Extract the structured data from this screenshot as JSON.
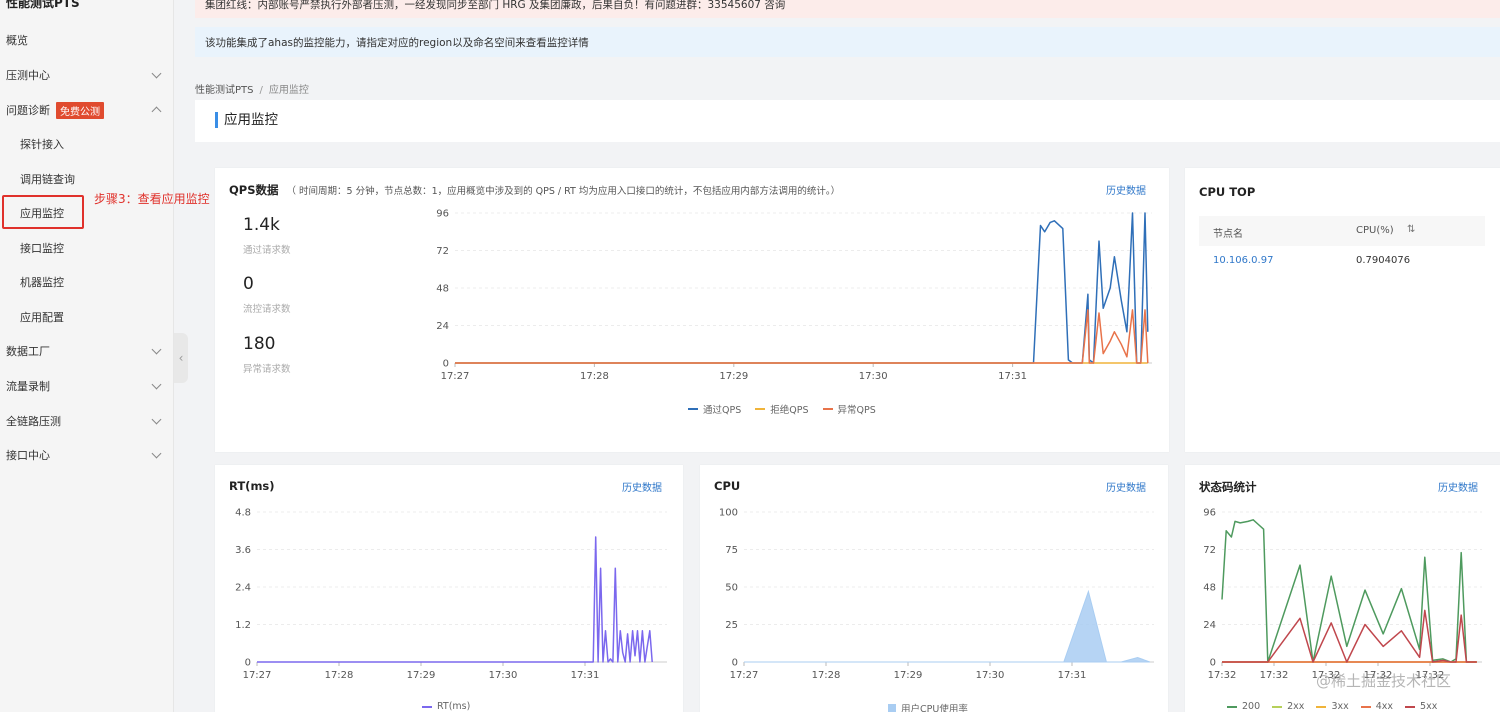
{
  "sidebar": {
    "title": "性能测试PTS",
    "items": [
      {
        "label": "概览",
        "level": 1,
        "chevron": ""
      },
      {
        "label": "压测中心",
        "level": 1,
        "chevron": "down"
      },
      {
        "label": "问题诊断",
        "level": 1,
        "chevron": "up",
        "badge": "免费公测"
      },
      {
        "label": "探针接入",
        "level": 2,
        "chevron": ""
      },
      {
        "label": "调用链查询",
        "level": 2,
        "chevron": ""
      },
      {
        "label": "应用监控",
        "level": 2,
        "chevron": "",
        "active": true
      },
      {
        "label": "接口监控",
        "level": 2,
        "chevron": ""
      },
      {
        "label": "机器监控",
        "level": 2,
        "chevron": ""
      },
      {
        "label": "应用配置",
        "level": 2,
        "chevron": ""
      },
      {
        "label": "数据工厂",
        "level": 1,
        "chevron": "down"
      },
      {
        "label": "流量录制",
        "level": 1,
        "chevron": "down"
      },
      {
        "label": "全链路压测",
        "level": 1,
        "chevron": "down"
      },
      {
        "label": "接口中心",
        "level": 1,
        "chevron": "down"
      }
    ],
    "collapse_icon": "chevron-left-icon"
  },
  "annotation": "步骤3：查看应用监控",
  "alerts": {
    "red": "集团红线：内部账号严禁执行外部者压测，一经发现同步至部门 HRG 及集团廉政，后果自负！有问题进群：33545607 咨询",
    "blue": "该功能集成了ahas的监控能力，请指定对应的region以及命名空间来查看监控详情"
  },
  "breadcrumb": {
    "root": "性能测试PTS",
    "separator": "/",
    "current": "应用监控"
  },
  "page_title": "应用监控",
  "qps_card": {
    "title": "QPS数据",
    "note": "（ 时间周期：5 分钟，节点总数：1，应用概览中涉及到的 QPS / RT 均为应用入口接口的统计，不包括应用内部方法调用的统计。）",
    "history_link": "历史数据",
    "stats": [
      {
        "value": "1.4k",
        "label": "通过请求数"
      },
      {
        "value": "0",
        "label": "流控请求数"
      },
      {
        "value": "180",
        "label": "异常请求数"
      }
    ]
  },
  "cpu_top_card": {
    "title": "CPU TOP",
    "columns": [
      "节点名",
      "CPU(%)"
    ],
    "sort_icon": "sort-icon",
    "rows": [
      {
        "node": "10.106.0.97",
        "cpu": "0.7904076"
      }
    ]
  },
  "rt_card": {
    "title": "RT(ms)",
    "history_link": "历史数据"
  },
  "cpu_card": {
    "title": "CPU",
    "history_link": "历史数据"
  },
  "status_card": {
    "title": "状态码统计",
    "history_link": "历史数据"
  },
  "watermark": "@稀土掘金技术社区",
  "colors": {
    "blue": "#2f6fb8",
    "yellow": "#f0b43a",
    "orange": "#e8734a",
    "purple": "#7b68ee",
    "cpu_fill": "#a9cdf2",
    "green": "#4e9a5e",
    "red": "#c0474d",
    "link": "#2f77c9"
  },
  "chart_data": [
    {
      "id": "qps",
      "type": "line",
      "x_ticks": [
        "17:27",
        "17:28",
        "17:29",
        "17:30",
        "17:31"
      ],
      "y_ticks": [
        "96",
        "72",
        "48",
        "24",
        "0"
      ],
      "ylim": [
        0,
        96
      ],
      "xlim": [
        0,
        5
      ],
      "series": [
        {
          "name": "通过QPS",
          "color": "#2f6fb8",
          "x": [
            0,
            4.15,
            4.2,
            4.23,
            4.27,
            4.3,
            4.36,
            4.4,
            4.43,
            4.47,
            4.5,
            4.54,
            4.55,
            4.58,
            4.62,
            4.65,
            4.7,
            4.73,
            4.78,
            4.82,
            4.86,
            4.89,
            4.92,
            4.95,
            4.97
          ],
          "y": [
            0,
            0,
            88,
            84,
            90,
            91,
            86,
            2,
            0,
            0,
            0,
            44,
            2,
            0,
            78,
            35,
            48,
            68,
            40,
            20,
            96,
            0,
            0,
            96,
            20
          ]
        },
        {
          "name": "拒绝QPS",
          "color": "#f0b43a",
          "x": [
            0,
            4.97
          ],
          "y": [
            0,
            0
          ]
        },
        {
          "name": "异常QPS",
          "color": "#e8734a",
          "x": [
            0,
            4.5,
            4.54,
            4.55,
            4.58,
            4.62,
            4.65,
            4.7,
            4.73,
            4.78,
            4.82,
            4.86,
            4.89,
            4.92,
            4.95,
            4.97
          ],
          "y": [
            0,
            0,
            34,
            0,
            0,
            32,
            6,
            14,
            20,
            12,
            4,
            34,
            0,
            0,
            34,
            0
          ]
        }
      ]
    },
    {
      "id": "rt",
      "type": "line",
      "x_ticks": [
        "17:27",
        "17:28",
        "17:29",
        "17:30",
        "17:31"
      ],
      "y_ticks": [
        "4.8",
        "3.6",
        "2.4",
        "1.2",
        "0"
      ],
      "ylim": [
        0,
        4.8
      ],
      "xlim": [
        0,
        5
      ],
      "series": [
        {
          "name": "RT(ms)",
          "color": "#7b68ee",
          "x": [
            0,
            4.1,
            4.13,
            4.16,
            4.19,
            4.22,
            4.25,
            4.28,
            4.31,
            4.34,
            4.37,
            4.4,
            4.43,
            4.46,
            4.49,
            4.52,
            4.55,
            4.58,
            4.61,
            4.64,
            4.67,
            4.7,
            4.73,
            4.76,
            4.79,
            4.82
          ],
          "y": [
            0,
            0,
            4.0,
            0,
            3.0,
            0,
            1.0,
            0,
            0.1,
            0,
            3.0,
            0,
            1.0,
            0.3,
            0,
            0.9,
            0,
            1.0,
            0.2,
            1.0,
            0,
            1.0,
            0,
            0.5,
            1.0,
            0
          ]
        }
      ]
    },
    {
      "id": "cpu",
      "type": "area",
      "x_ticks": [
        "17:27",
        "17:28",
        "17:29",
        "17:30",
        "17:31"
      ],
      "y_ticks": [
        "100",
        "75",
        "50",
        "25",
        "0"
      ],
      "ylim": [
        0,
        100
      ],
      "xlim": [
        0,
        5
      ],
      "series": [
        {
          "name": "用户CPU使用率",
          "color": "#a9cdf2",
          "x": [
            0,
            3.9,
            4.2,
            4.42,
            4.6,
            4.8,
            4.95
          ],
          "y": [
            0,
            0,
            47,
            0,
            0,
            3,
            0
          ]
        }
      ]
    },
    {
      "id": "status",
      "type": "line",
      "x_ticks": [
        "17:32",
        "17:32",
        "17:32",
        "17:32",
        "17:32"
      ],
      "y_ticks": [
        "96",
        "72",
        "48",
        "24",
        "0"
      ],
      "ylim": [
        0,
        96
      ],
      "xlim": [
        0,
        5
      ],
      "series": [
        {
          "name": "200",
          "color": "#4e9a5e",
          "x": [
            0,
            0.08,
            0.18,
            0.25,
            0.35,
            0.5,
            0.6,
            0.7,
            0.8,
            0.88,
            1.5,
            1.75,
            2.1,
            2.4,
            2.75,
            3.1,
            3.45,
            3.8,
            3.9,
            4.05,
            4.25,
            4.4,
            4.5,
            4.6,
            4.7,
            4.8,
            4.9
          ],
          "y": [
            40,
            84,
            80,
            90,
            89,
            90,
            91,
            88,
            85,
            0,
            62,
            0,
            55,
            10,
            46,
            18,
            47,
            8,
            67,
            1,
            2,
            0,
            2,
            70,
            0,
            0,
            0
          ]
        },
        {
          "name": "2xx",
          "color": "#b6d05a",
          "x": [
            0,
            4.9
          ],
          "y": [
            0,
            0
          ]
        },
        {
          "name": "3xx",
          "color": "#f0b43a",
          "x": [
            0,
            4.9
          ],
          "y": [
            0,
            0
          ]
        },
        {
          "name": "4xx",
          "color": "#e8734a",
          "x": [
            0,
            4.9
          ],
          "y": [
            0,
            0
          ]
        },
        {
          "name": "5xx",
          "color": "#c0474d",
          "x": [
            0,
            0.88,
            1.5,
            1.75,
            2.1,
            2.4,
            2.75,
            3.1,
            3.45,
            3.8,
            3.9,
            4.05,
            4.25,
            4.4,
            4.5,
            4.6,
            4.7,
            4.8,
            4.9
          ],
          "y": [
            0,
            0,
            28,
            0,
            25,
            0,
            24,
            10,
            20,
            3,
            33,
            0,
            1,
            0,
            0,
            30,
            0,
            0,
            0
          ]
        }
      ]
    }
  ]
}
